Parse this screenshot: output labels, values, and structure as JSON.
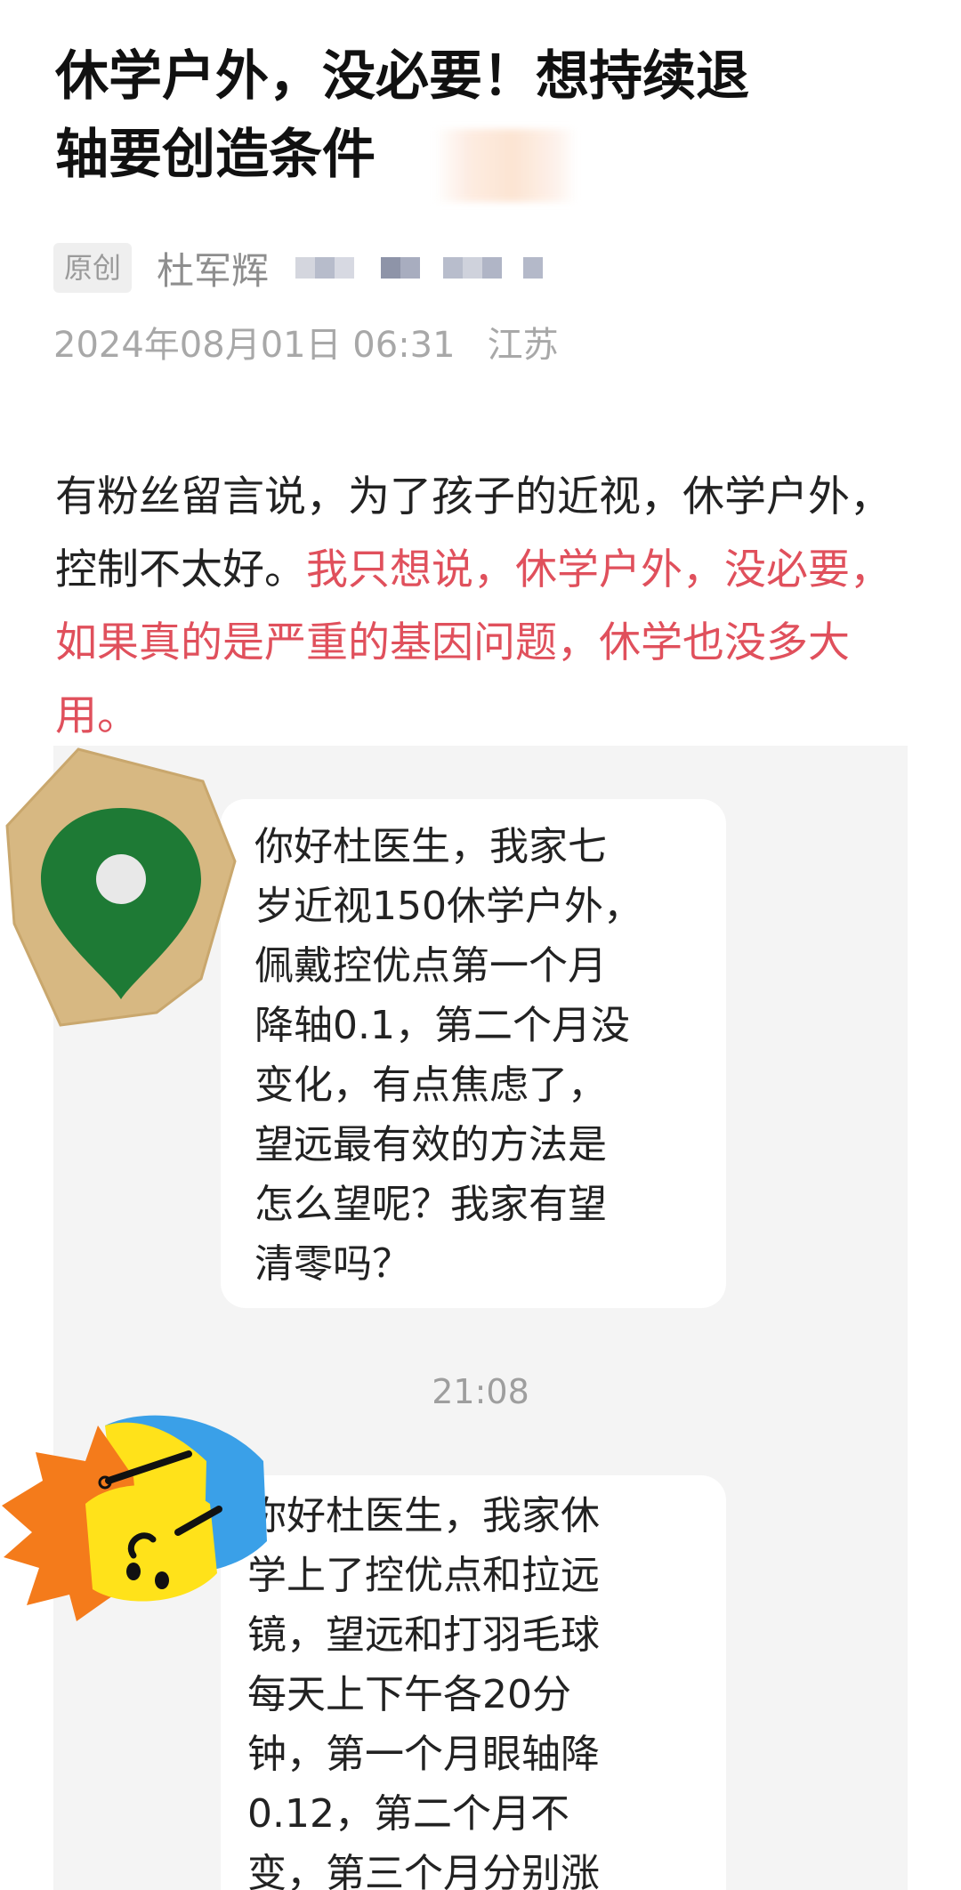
{
  "article": {
    "title_line1": "休学户外，没必要！想持续退",
    "title_line2": "轴要创造条件",
    "badge": "原创",
    "author": "杜军辉",
    "date": "2024年08月01日 06:31",
    "location": "江苏"
  },
  "body": {
    "normal": "有粉丝留言说，为了孩子的近视，休学户外，控制不太好。",
    "highlight": "我只想说，休学户外，没必要，如果真的是严重的基因问题，休学也没多大用。"
  },
  "chat": {
    "message1_lines": [
      "你好杜医生，我家七",
      "岁近视150休学户外，",
      "佩戴控优点第一个月",
      "降轴0.1，第二个月没",
      "变化，有点焦虑了，",
      "望远最有效的方法是",
      "怎么望呢？我家有望",
      "清零吗？"
    ],
    "timestamp": "21:08",
    "message2_lines": [
      "你好杜医生，我家休",
      "学上了控优点和拉远",
      "镜，望远和打羽毛球",
      "每天上下午各20分",
      "钟，第一个月眼轴降",
      "0.12，第二个月不",
      "变，第三个月分别涨"
    ]
  },
  "colors": {
    "highlight_red": "#e0505c",
    "chat_background": "#f4f4f4",
    "pin_green": "#1e7a35",
    "pin_tag_tan": "#d7b882",
    "face_orange": "#f47b1b",
    "face_yellow": "#ffe21a",
    "face_blue": "#3aa0e8"
  },
  "stickers": [
    "location-pin-sticker",
    "emoji-face-sticker"
  ]
}
